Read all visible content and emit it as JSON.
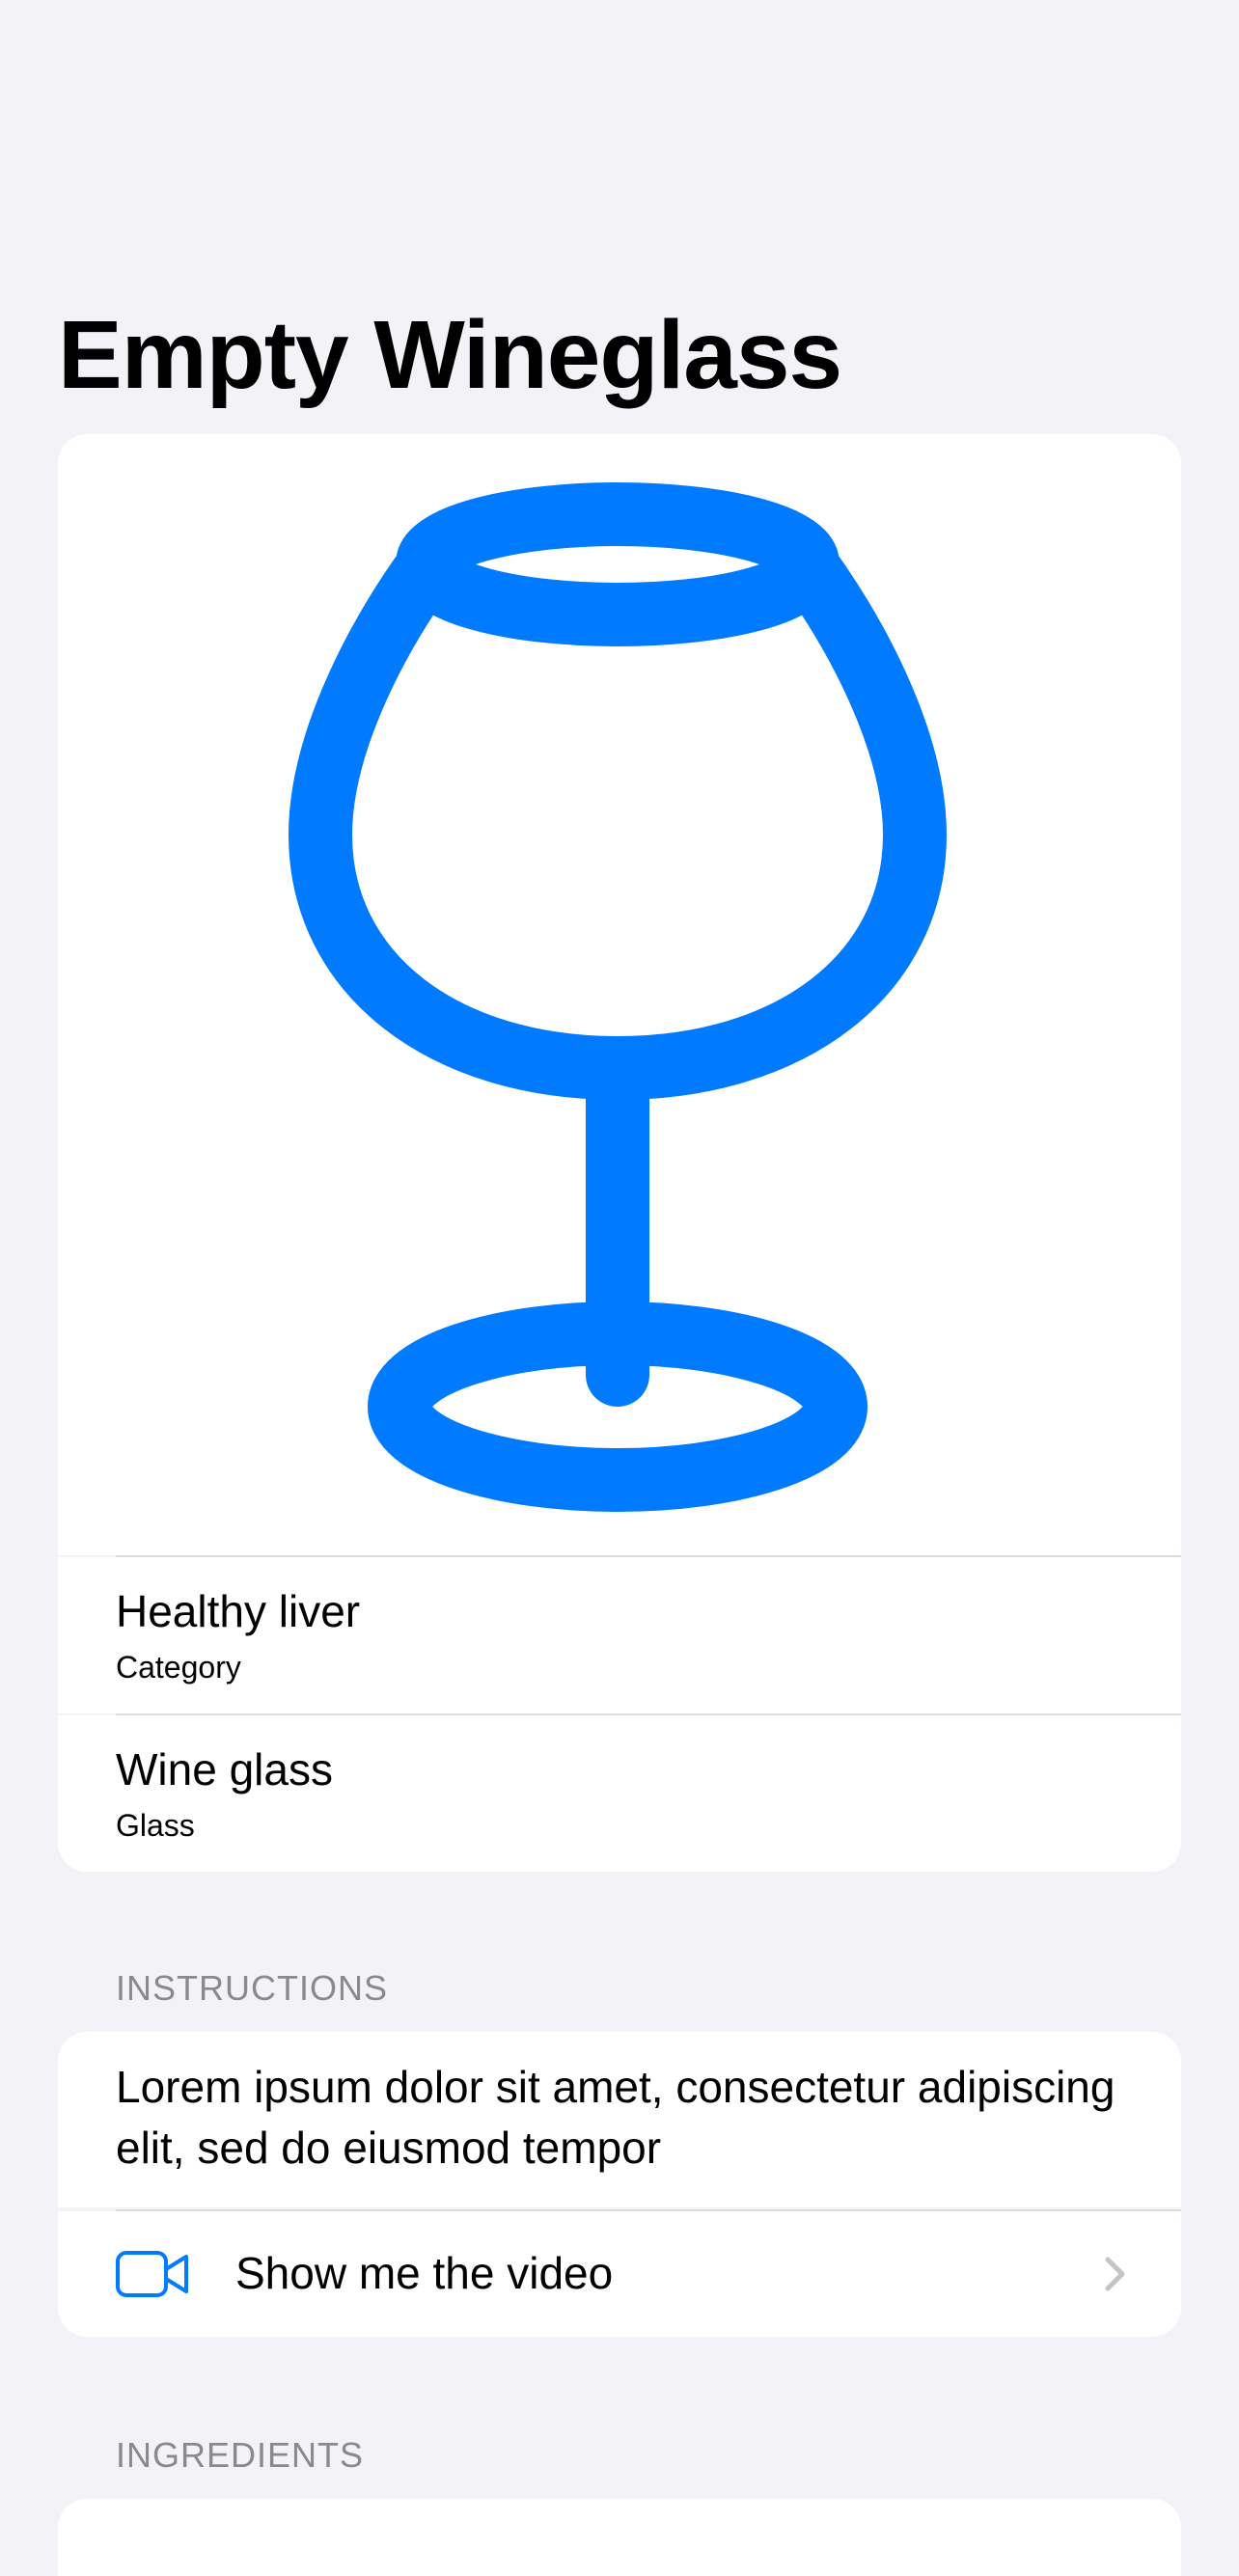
{
  "header": {
    "title": "Empty Wineglass"
  },
  "hero": {
    "icon": "wineglass-icon",
    "accent_color": "#007aff"
  },
  "details": [
    {
      "value": "Healthy liver",
      "label": "Category"
    },
    {
      "value": "Wine glass",
      "label": "Glass"
    }
  ],
  "instructions": {
    "header": "INSTRUCTIONS",
    "text": "Lorem ipsum dolor sit amet, consectetur adipiscing elit, sed do eiusmod tempor",
    "video_label": "Show me the video",
    "video_icon": "video-camera-icon",
    "chevron_icon": "chevron-right-icon"
  },
  "ingredients": {
    "header": "INGREDIENTS"
  }
}
